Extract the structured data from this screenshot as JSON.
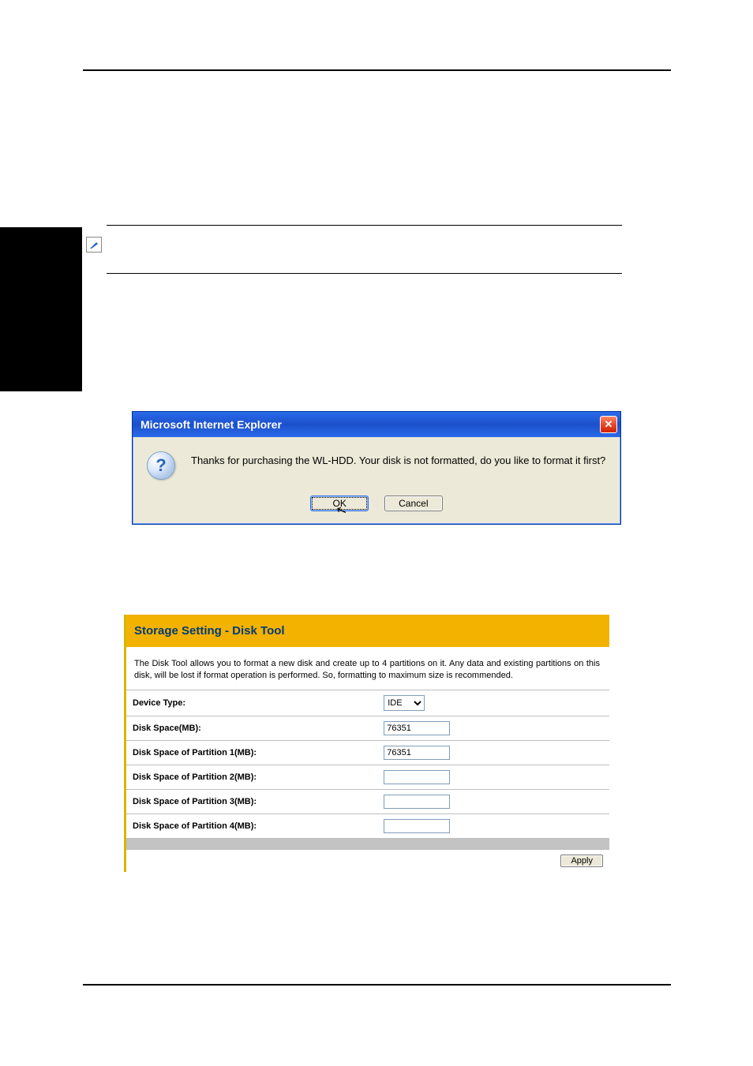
{
  "dialog": {
    "title": "Microsoft Internet Explorer",
    "close_glyph": "✕",
    "question_glyph": "?",
    "message": "Thanks for purchasing the WL-HDD. Your disk is not formatted, do you like to format it first?",
    "ok_label": "OK",
    "cancel_label": "Cancel"
  },
  "panel": {
    "title": "Storage Setting - Disk Tool",
    "description": "The Disk Tool allows you to format a new disk and create up to 4 partitions on it. Any data and existing partitions on this disk, will be lost if format operation is performed. So, formatting to maximum size is recommended.",
    "rows": {
      "device_type_label": "Device Type:",
      "device_type_value": "IDE",
      "disk_space_label": "Disk Space(MB):",
      "disk_space_value": "76351",
      "p1_label": "Disk Space of Partition 1(MB):",
      "p1_value": "76351",
      "p2_label": "Disk Space of Partition 2(MB):",
      "p2_value": "",
      "p3_label": "Disk Space of Partition 3(MB):",
      "p3_value": "",
      "p4_label": "Disk Space of Partition 4(MB):",
      "p4_value": ""
    },
    "apply_label": "Apply"
  }
}
